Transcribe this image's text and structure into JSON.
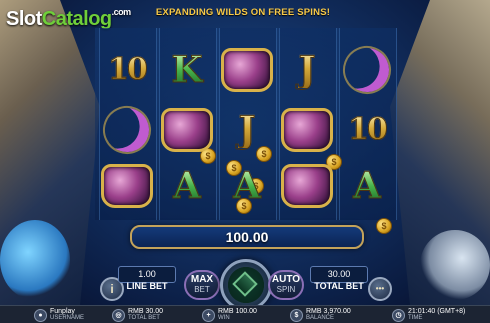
{
  "brand": {
    "logo_slot": "Slot",
    "logo_catalog": "Catalog",
    "logo_com": ".com"
  },
  "banner": {
    "text": "EXPANDING WILDS ON FREE SPINS!"
  },
  "win": {
    "amount": "100.00"
  },
  "controls": {
    "line_bet_value": "1.00",
    "line_bet_label": "LINE BET",
    "total_bet_value": "30.00",
    "total_bet_label": "TOTAL BET",
    "max_bet_top": "MAX",
    "max_bet_bottom": "BET",
    "auto_spin_top": "AUTO",
    "auto_spin_bottom": "SPIN",
    "info_glyph": "i",
    "menu_glyph": "•••"
  },
  "reels": [
    [
      "10",
      "moon",
      "crown"
    ],
    [
      "K",
      "crown",
      "A"
    ],
    [
      "crown",
      "J",
      "A"
    ],
    [
      "J",
      "crown",
      "crown"
    ],
    [
      "moon",
      "10",
      "A"
    ]
  ],
  "footer": {
    "username_value": "Funplay",
    "username_label": "USERNAME",
    "totalbet_value": "RMB 30.00",
    "totalbet_label": "TOTAL BET",
    "win_value": "RMB 100.00",
    "win_label": "WIN",
    "balance_value": "RMB 3,970.00",
    "balance_label": "BALANCE",
    "time_value": "21:01:40 (GMT+8)",
    "time_label": "TIME"
  },
  "colors": {
    "accent_gold": "#c4a35a",
    "win_bar": "#0b2454",
    "logo_green": "#6fcf3a"
  },
  "icons": {
    "user": "user-icon",
    "bet": "chip-icon",
    "win": "plus-icon",
    "balance": "dollar-icon",
    "time": "clock-icon"
  }
}
